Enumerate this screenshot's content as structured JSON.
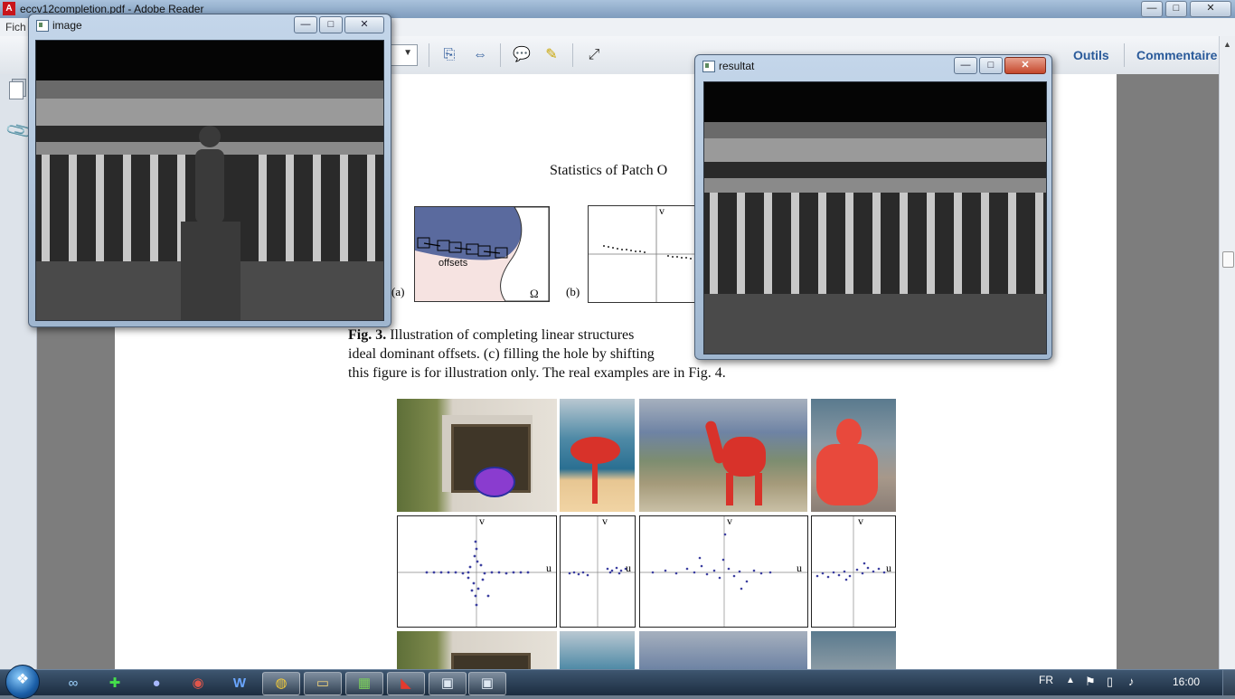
{
  "reader": {
    "title": "eccv12completion.pdf - Adobe Reader",
    "menu_file": "Fich",
    "right_tabs": {
      "tools": "Outils",
      "comment": "Commentaire"
    },
    "logo_letter": "A"
  },
  "pdf": {
    "section_heading": "Statistics of Patch O",
    "fig_a_label": "(a)",
    "fig_a_text": "offsets",
    "fig_a_omega": "Ω",
    "fig_b_label": "(b)",
    "fig_b_axis_v": "v",
    "caption": {
      "fig_number": "Fig. 3.",
      "line1_rest": " Illustration of completing linear structures",
      "line2": "ideal dominant offsets. (c) filling the hole by shifting",
      "line3": "this figure is for illustration only. The real examples are in Fig. 4."
    },
    "scatter_labels": {
      "u": "u",
      "v": "v"
    }
  },
  "image_window": {
    "title": "image"
  },
  "result_window": {
    "title": "resultat"
  },
  "window_controls": {
    "minimize": "—",
    "maximize": "□",
    "close": "✕"
  },
  "taskbar": {
    "language": "FR",
    "clock": "16:00",
    "pinned_apps": [
      "link-icon",
      "plus-icon",
      "eclipse-icon",
      "media-icon",
      "word-icon",
      "chrome-icon",
      "folder-icon",
      "grid-icon",
      "adobe-reader-icon",
      "window-icon",
      "window-icon"
    ]
  },
  "colors": {
    "region_blue": "#5a6a9e",
    "region_pink": "#f6e3e1",
    "overlay_red": "#d8322a",
    "dot_blue": "#3c3fa0"
  }
}
